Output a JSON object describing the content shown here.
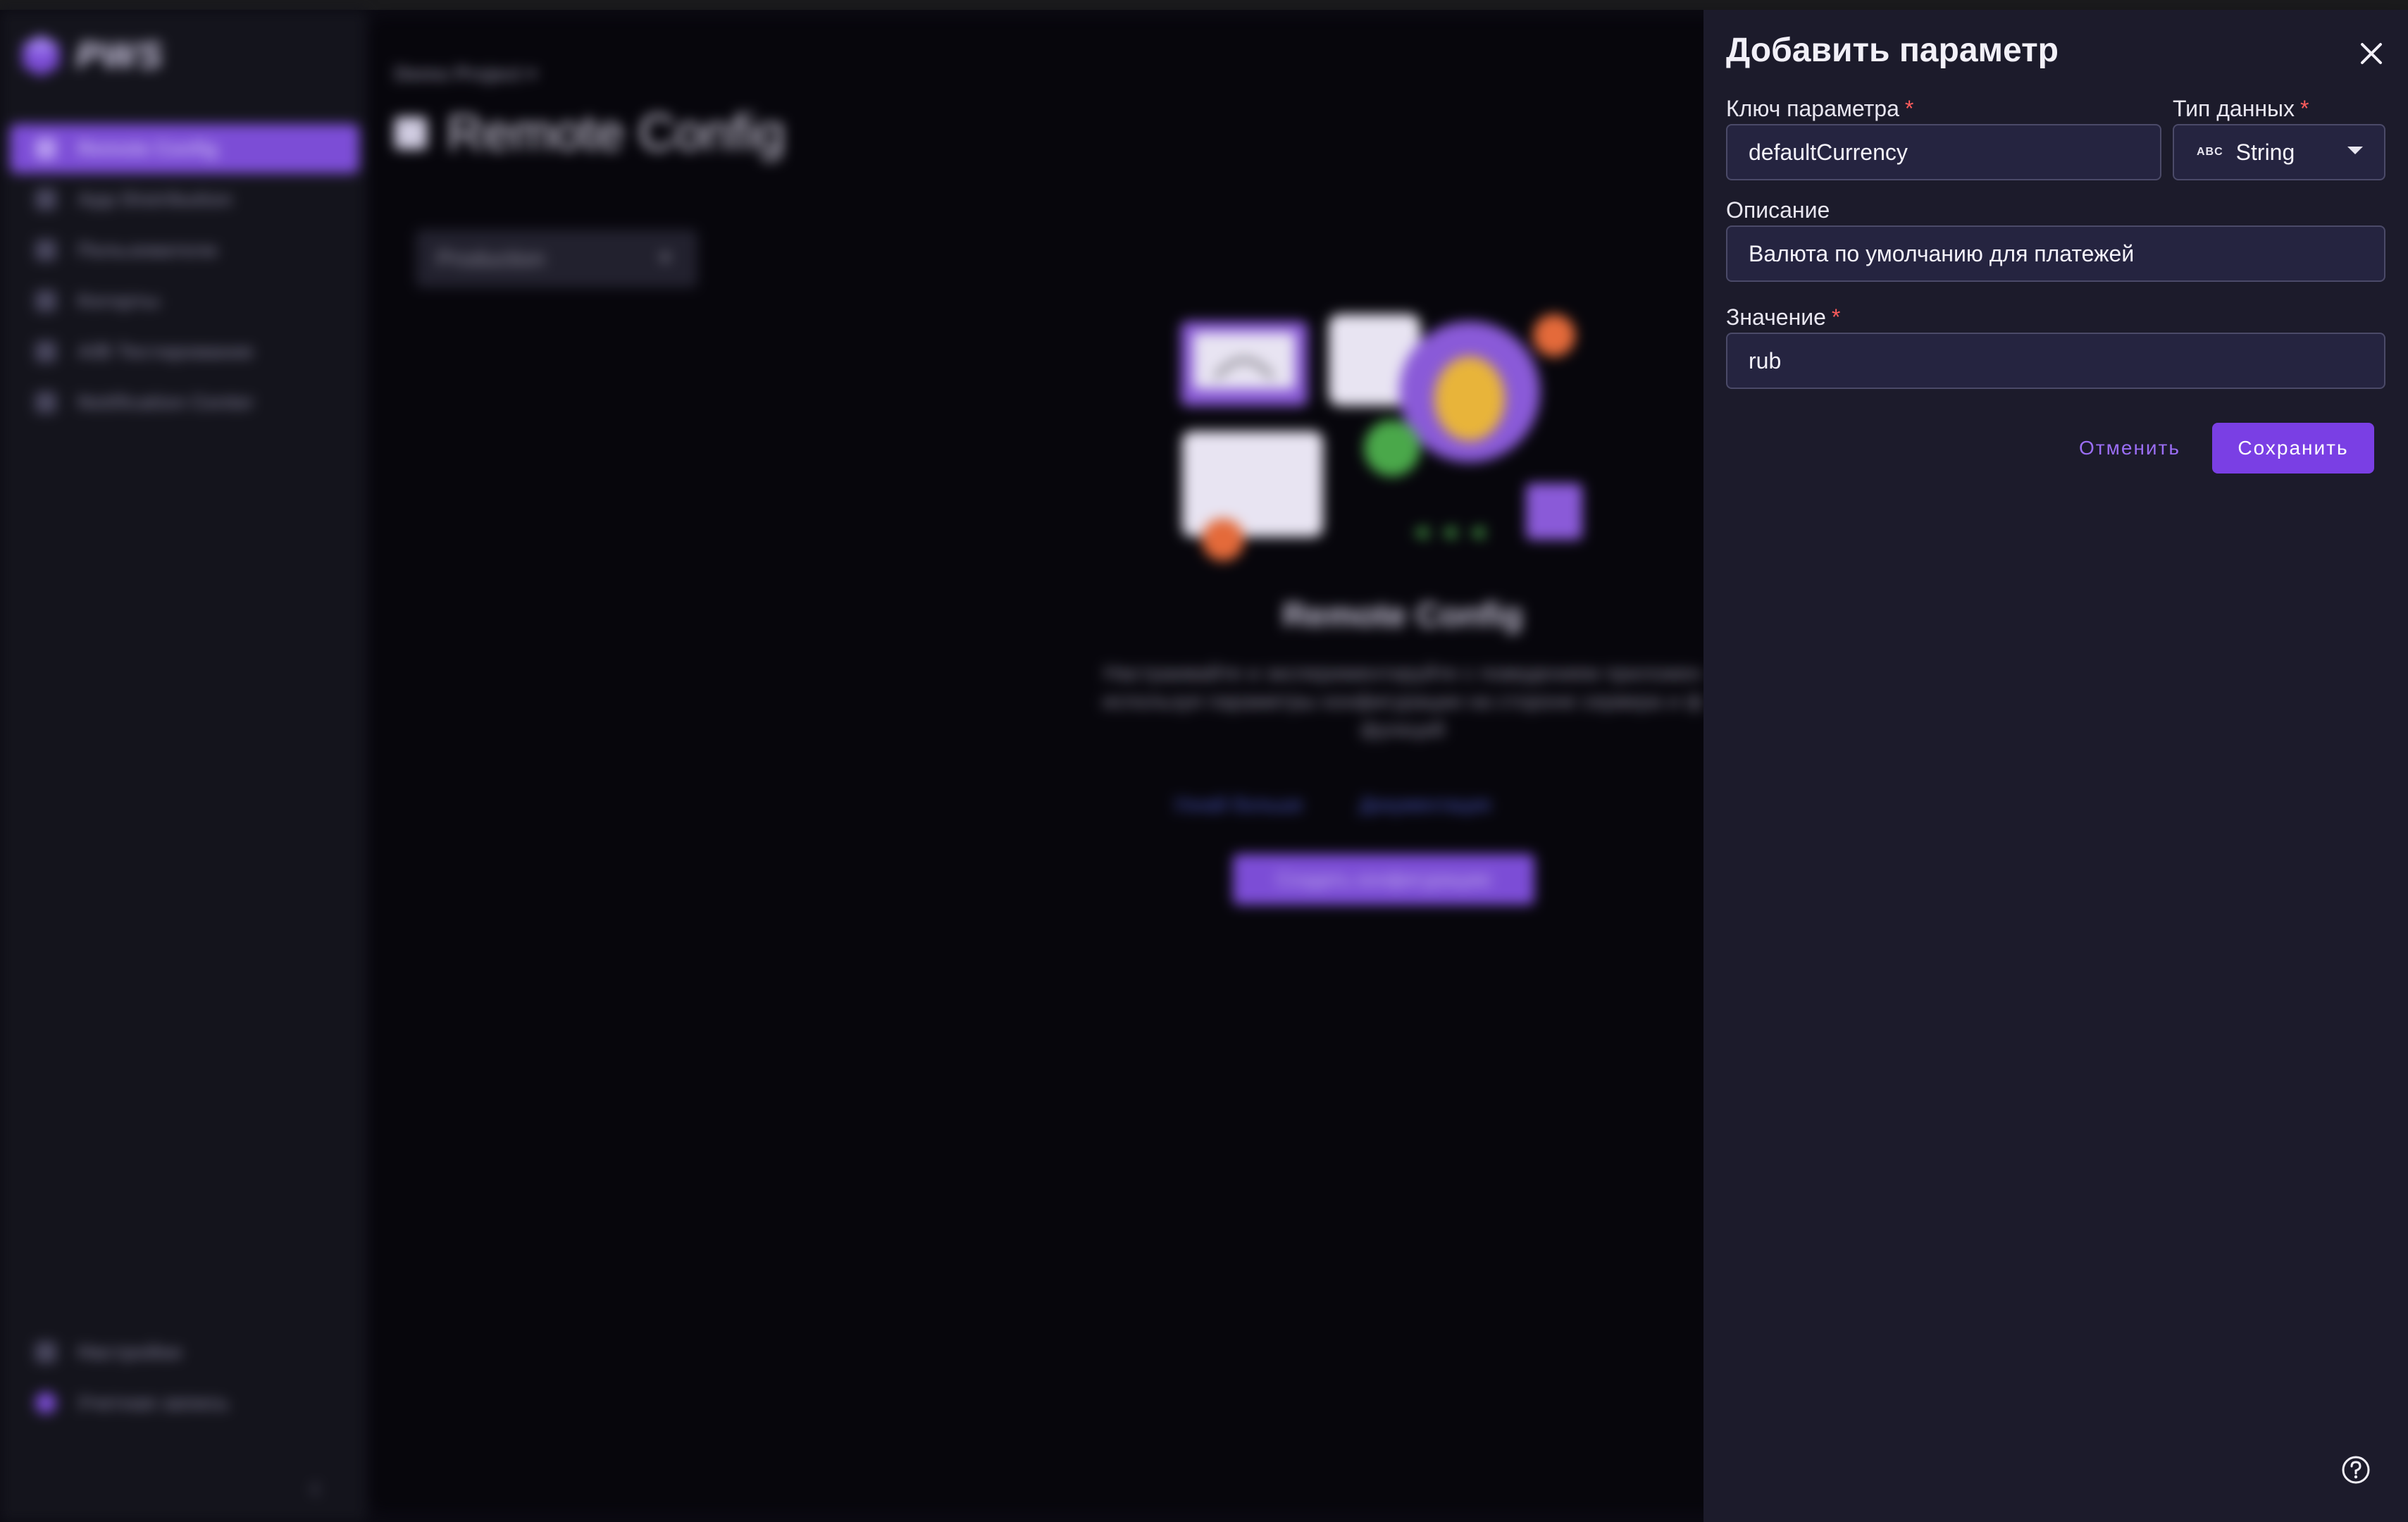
{
  "app": {
    "logo_text": "PWS"
  },
  "sidebar": {
    "items": [
      {
        "label": "Remote Config",
        "active": true
      },
      {
        "label": "App Distribution"
      },
      {
        "label": "Пользователи"
      },
      {
        "label": "Когорты"
      },
      {
        "label": "A/B Тестирование"
      },
      {
        "label": "Notification Center"
      }
    ],
    "bottom": [
      {
        "label": "Настройки"
      },
      {
        "label": "Учетная запись"
      }
    ],
    "collapse_icon": "‹"
  },
  "main": {
    "breadcrumb": "Demo Project ▾",
    "title": "Remote Config",
    "env_select": "Production",
    "empty_state": {
      "title": "Remote Config",
      "description_lines": [
        "Настраивайте и экспериментируйте с поведением приложен",
        "используя параметры конфигурации на стороне сервера и ф",
        "функций"
      ],
      "link_learn": "Узнай больше",
      "link_docs": "Документация",
      "create_button": "Создать конфигурацию"
    }
  },
  "dialog": {
    "title": "Добавить параметр",
    "required_marker": "*",
    "key_label": "Ключ параметра",
    "key_value": "defaultCurrency",
    "type_label": "Тип данных",
    "type_icon": "ABC",
    "type_value": "String",
    "desc_label": "Описание",
    "desc_value": "Валюта по умолчанию для платежей",
    "value_label": "Значение",
    "value_value": "rub",
    "cancel_label": "Отменить",
    "save_label": "Сохранить"
  },
  "colors": {
    "accent": "#7a3fe4",
    "panel_bg": "#1c1b2b",
    "field_bg": "#252440",
    "required": "#ff5c5c"
  }
}
